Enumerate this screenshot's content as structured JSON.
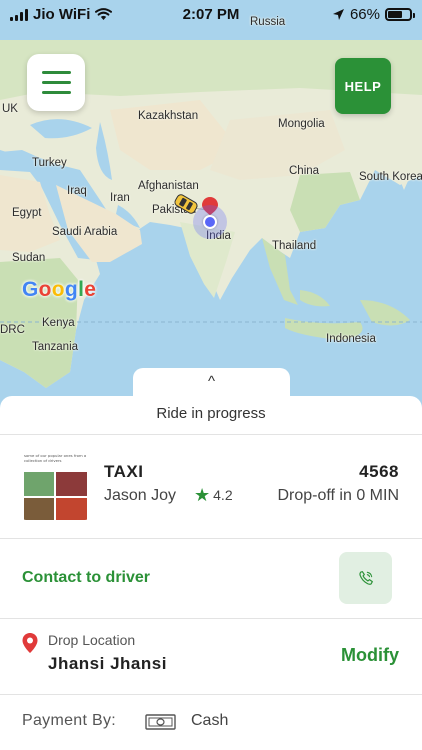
{
  "status_bar": {
    "carrier": "Jio WiFi",
    "time": "2:07 PM",
    "battery": "66%"
  },
  "map": {
    "labels": {
      "russia": "Russia",
      "uk": "UK",
      "kazakhstan": "Kazakhstan",
      "mongolia": "Mongolia",
      "turkey": "Turkey",
      "china": "China",
      "south_korea": "South Korea",
      "iraq": "Iraq",
      "iran": "Iran",
      "afghanistan": "Afghanistan",
      "egypt": "Egypt",
      "pakistan": "Pakistan",
      "saudi_arabia": "Saudi Arabia",
      "india": "India",
      "thailand": "Thailand",
      "sudan": "Sudan",
      "kenya": "Kenya",
      "drc": "DRC",
      "tanzania": "Tanzania",
      "indonesia": "Indonesia"
    },
    "attribution": "Google",
    "help_label": "HELP",
    "colors": {
      "water": "#a9d3ec",
      "land": "#e9ebd8",
      "forest": "#c9dfb4",
      "desert": "#efe6cf"
    }
  },
  "sheet": {
    "handle_icon": "^",
    "title": "Ride in progress",
    "driver": {
      "vehicle_type": "TAXI",
      "vehicle_number": "4568",
      "name": "Jason Joy",
      "rating": "4.2",
      "eta": "Drop-off in 0 MIN",
      "photo_caption": "some of our popular ones from a collection of drivers"
    },
    "contact_label": "Contact to driver",
    "drop": {
      "caption": "Drop Location",
      "value": "Jhansi Jhansi",
      "modify_label": "Modify"
    },
    "payment": {
      "caption": "Payment By:",
      "value": "Cash"
    }
  },
  "colors": {
    "brand_green": "#2b9137",
    "call_bg": "#e1efe2",
    "pin_red": "#e03a3a",
    "location_blue": "#5966f7"
  },
  "icons": {
    "menu": "hamburger-icon",
    "call": "phone-icon",
    "drop": "location-pin-icon",
    "payment": "cash-icon",
    "rating": "star-icon"
  }
}
